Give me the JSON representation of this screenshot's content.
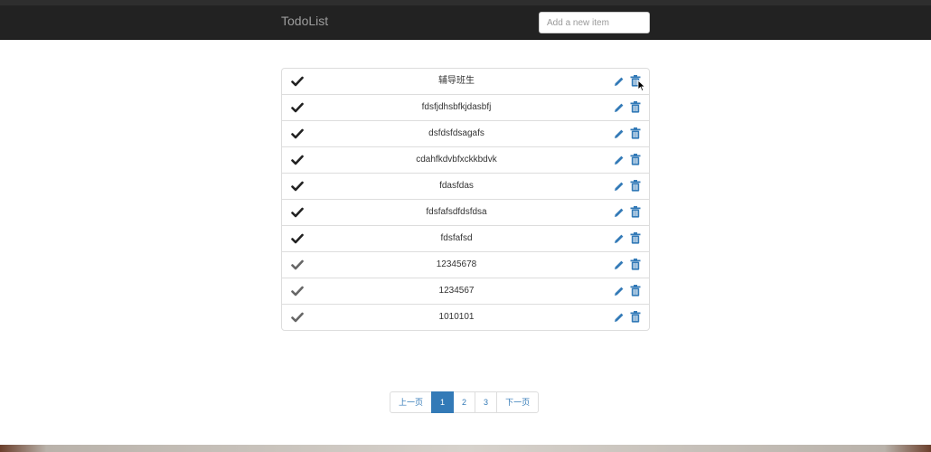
{
  "navbar": {
    "brand": "TodoList",
    "new_item_placeholder": "Add a new item"
  },
  "todos": [
    {
      "text": "辅导班生",
      "checked": true
    },
    {
      "text": "fdsfjdhsbfkjdasbfj",
      "checked": true
    },
    {
      "text": "dsfdsfdsagafs",
      "checked": true
    },
    {
      "text": "cdahfkdvbfxckkbdvk",
      "checked": true
    },
    {
      "text": "fdasfdas",
      "checked": true
    },
    {
      "text": "fdsfafsdfdsfdsa",
      "checked": true
    },
    {
      "text": "fdsfafsd",
      "checked": true
    },
    {
      "text": "12345678",
      "checked": false
    },
    {
      "text": "1234567",
      "checked": false
    },
    {
      "text": "1010101",
      "checked": false
    }
  ],
  "pagination": {
    "prev_label": "上一页",
    "pages": [
      "1",
      "2",
      "3"
    ],
    "active_page": "1",
    "next_label": "下一页"
  },
  "colors": {
    "accent": "#337ab7",
    "navbar_bg": "#222222",
    "check_done": "#222222",
    "check_pending": "#666666"
  },
  "icons": {
    "check": "check-icon",
    "edit": "pencil-icon",
    "delete": "trash-icon"
  }
}
